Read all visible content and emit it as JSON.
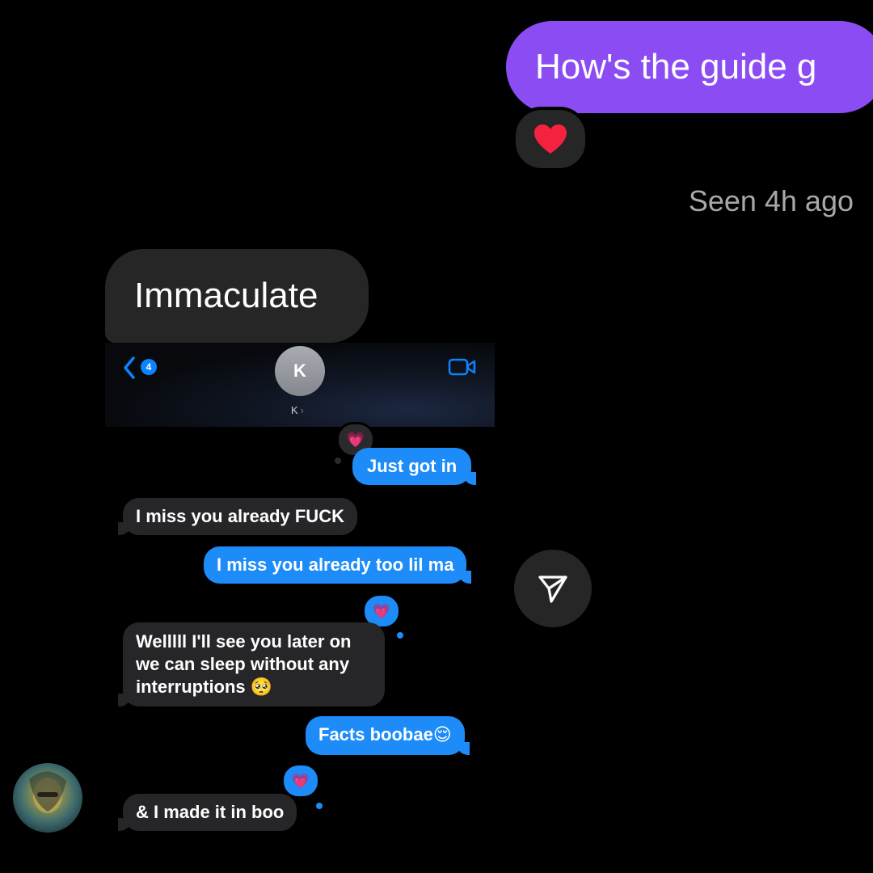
{
  "thread": {
    "sent_message": "How's the guide g",
    "reaction": "❤️",
    "seen_status": "Seen 4h ago",
    "received_message": "Immaculate"
  },
  "screenshot": {
    "back_count": "4",
    "contact_initial": "K",
    "contact_name": "K",
    "messages": [
      {
        "text": "Just got in",
        "side": "sent"
      },
      {
        "text": "I miss you already FUCK",
        "side": "received"
      },
      {
        "text": "I miss you already too lil ma",
        "side": "sent"
      },
      {
        "text": "Welllll I'll see you later on we can sleep without any interruptions 🥺",
        "side": "received"
      },
      {
        "text": "Facts boobae😌",
        "side": "sent"
      },
      {
        "text": "& I made it in boo",
        "side": "received"
      }
    ],
    "tapback": "💗"
  },
  "colors": {
    "purple_bubble": "#8c4cf4",
    "imessage_blue": "#1d8cf8",
    "dark_bubble": "#262626"
  }
}
